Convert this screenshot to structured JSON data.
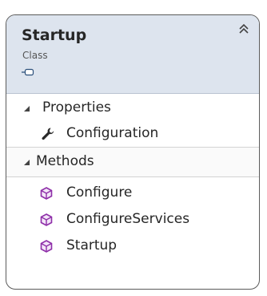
{
  "class_shape": {
    "name": "Startup",
    "stereotype": "Class",
    "icon": "class-shortcut-icon",
    "collapse_icon": "double-chevron-up-icon"
  },
  "compartments": [
    {
      "title": "Properties",
      "expanded": true,
      "members": [
        {
          "label": "Configuration",
          "icon": "wrench-icon"
        }
      ]
    },
    {
      "title": "Methods",
      "expanded": true,
      "members": [
        {
          "label": "Configure",
          "icon": "method-cube-icon"
        },
        {
          "label": "ConfigureServices",
          "icon": "method-cube-icon"
        },
        {
          "label": "Startup",
          "icon": "method-cube-icon"
        }
      ]
    }
  ],
  "colors": {
    "header_bg": "#dde4ee",
    "method_icon": "#8e2ea8",
    "border": "#5b5b5b"
  }
}
